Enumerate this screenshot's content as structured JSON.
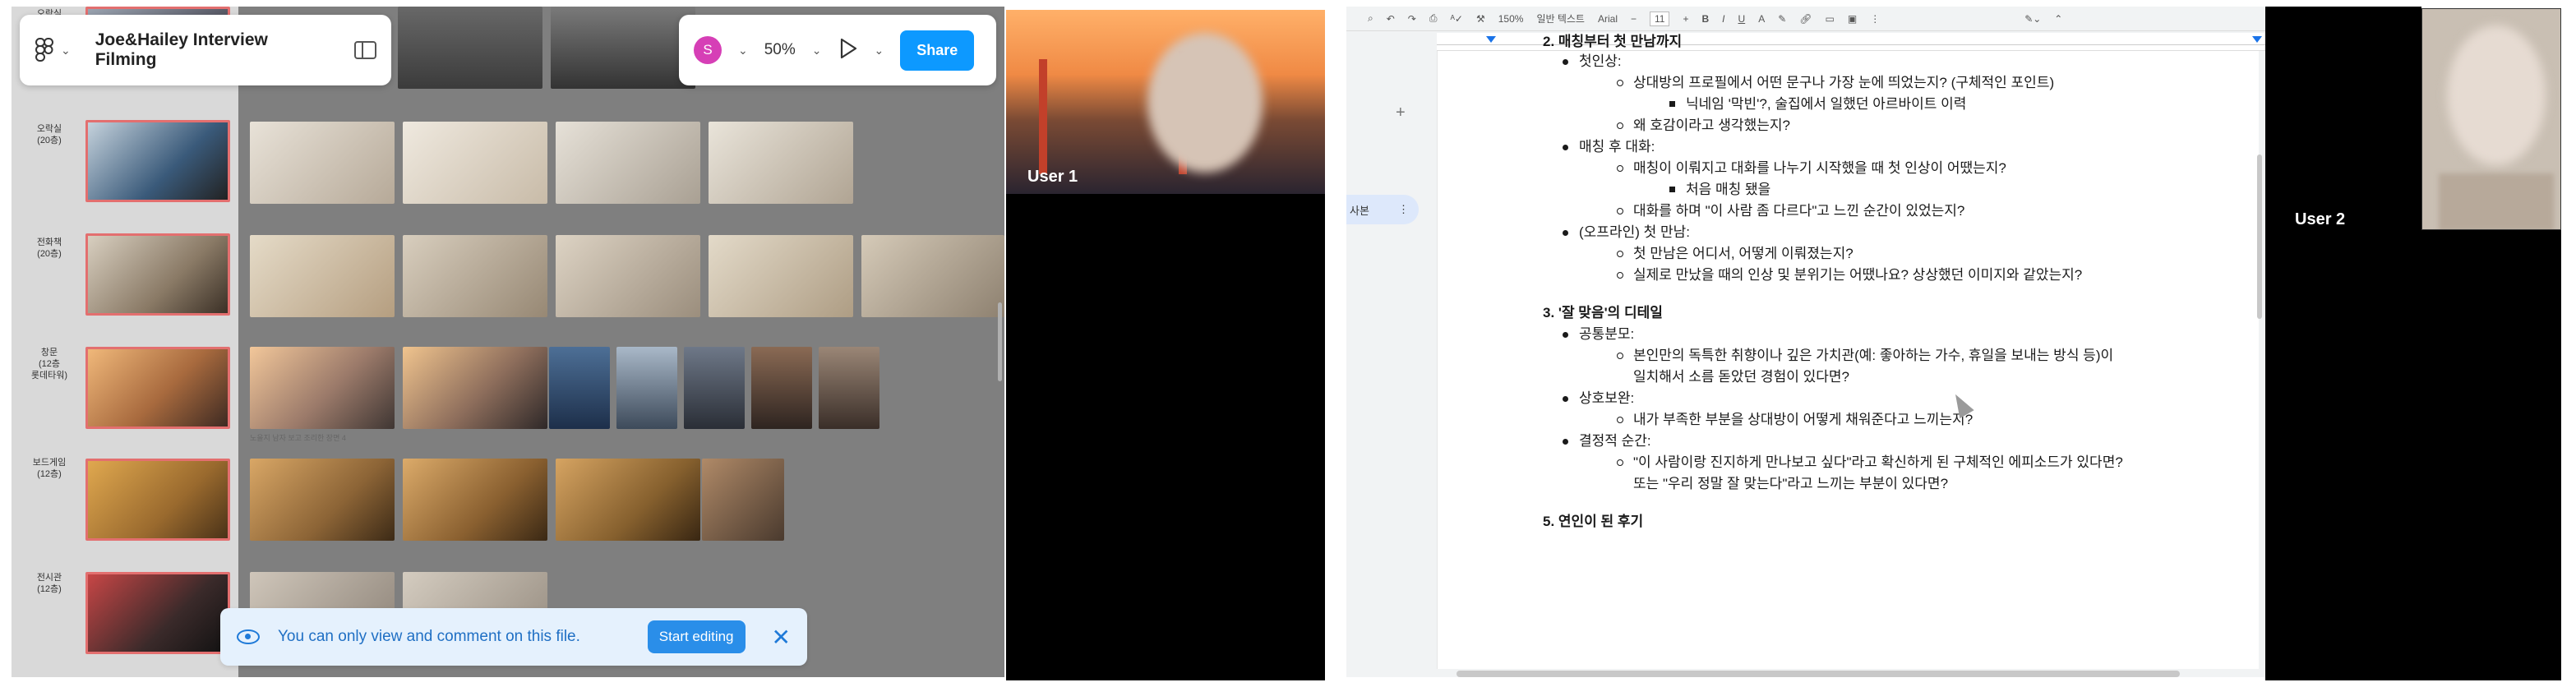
{
  "figma": {
    "file_title": "Joe&Hailey Interview Filming",
    "zoom": "50%",
    "avatar_initial": "S",
    "share_label": "Share",
    "row_labels": [
      "오락실",
      "오락실\n(20층)",
      "전화책\n(20층)",
      "창문\n(12층\n롯데타워)",
      "보드게임\n(12층)",
      "전시관\n(12층)"
    ],
    "photo_caption": "노을지 남자 보고 조리한 장면 4",
    "banner_text": "You can only view and comment on this file.",
    "start_editing_label": "Start editing"
  },
  "video": {
    "user1_label": "User 1",
    "user2_label": "User 2"
  },
  "docs": {
    "toolbar": {
      "zoom": "150%",
      "style": "일반 텍스트",
      "font": "Arial",
      "size": "11"
    },
    "outline_label": "사본",
    "lines": [
      {
        "type": "h",
        "text": "2. 매칭부터 첫 만남까지"
      },
      {
        "type": "b",
        "text": "첫인상:"
      },
      {
        "type": "c",
        "text": "상대방의 프로필에서 어떤 문구나 가장 눈에 띄었는지? (구체적인 포인트)"
      },
      {
        "type": "s",
        "text": "닉네임 '막빈'?, 술집에서 일했던 아르바이트 이력"
      },
      {
        "type": "c",
        "text": "왜 호감이라고 생각했는지?"
      },
      {
        "type": "b",
        "text": "매칭 후 대화:"
      },
      {
        "type": "c",
        "text": "매칭이 이뤄지고 대화를 나누기 시작했을 때 첫 인상이 어땠는지?"
      },
      {
        "type": "s",
        "text": "처음 매칭 됐을"
      },
      {
        "type": "c",
        "text": "대화를 하며 \"이 사람 좀 다르다\"고 느낀 순간이 있었는지?"
      },
      {
        "type": "b",
        "text": "(오프라인) 첫 만남:"
      },
      {
        "type": "c",
        "text": "첫 만남은 어디서, 어떻게 이뤄졌는지?"
      },
      {
        "type": "c",
        "text": "실제로 만났을 때의 인상 및 분위기는 어땠나요? 상상했던 이미지와 같았는지?"
      },
      {
        "type": "h",
        "text": "3. '잘 맞음'의 디테일"
      },
      {
        "type": "b",
        "text": "공통분모:"
      },
      {
        "type": "c",
        "text": "본인만의 독특한 취향이나 깊은 가치관(예: 좋아하는 가수, 휴일을 보내는 방식 등)이"
      },
      {
        "type": "p",
        "text": "일치해서 소름 돋았던 경험이 있다면?"
      },
      {
        "type": "b",
        "text": "상호보완:"
      },
      {
        "type": "c",
        "text": "내가 부족한 부분을 상대방이 어떻게 채워준다고 느끼는지?"
      },
      {
        "type": "b",
        "text": "결정적 순간:"
      },
      {
        "type": "c",
        "text": "\"이 사람이랑 진지하게 만나보고 싶다\"라고 확신하게 된 구체적인 에피소드가 있다면?"
      },
      {
        "type": "p",
        "text": "또는 \"우리 정말 잘 맞는다\"라고 느끼는 부분이 있다면?"
      },
      {
        "type": "h",
        "text": "5. 연인이 된 후기"
      }
    ]
  },
  "colors": {
    "accent": "#0d99ff",
    "thumb_border": "#e36f6f",
    "banner_bg": "#e5f1fd"
  }
}
